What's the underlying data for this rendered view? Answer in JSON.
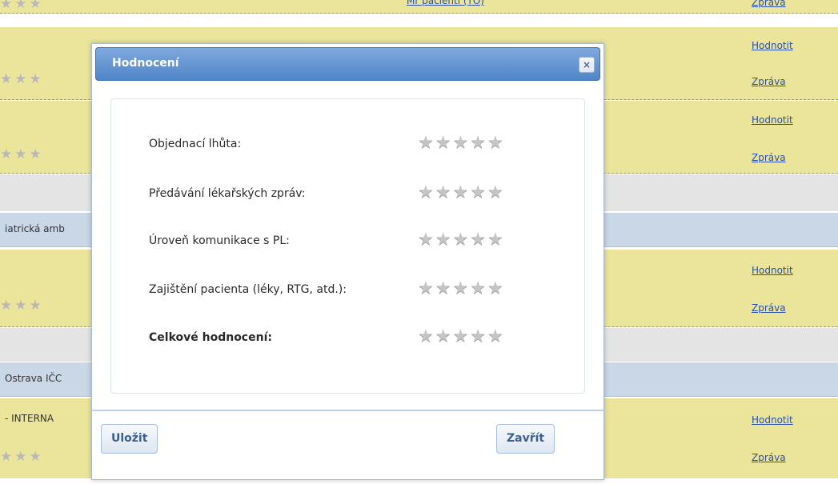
{
  "background": {
    "top_link": "Mr pacienti (TO)",
    "links": [
      {
        "label": "Zpráva"
      },
      {
        "label": "Hodnotit"
      },
      {
        "label": "Zpráva"
      },
      {
        "label": "Hodnotit"
      },
      {
        "label": "Zpráva"
      },
      {
        "label": "Hodnotit"
      },
      {
        "label": "Zpráva"
      },
      {
        "label": "Hodnotit"
      },
      {
        "label": "Zpráva"
      }
    ],
    "section_labels": [
      "iatrická amb",
      "Ostrava IČC",
      "- INTERNA"
    ]
  },
  "dialog": {
    "title": "Hodnocení",
    "close_symbol": "×",
    "rating_rows": [
      {
        "label": "Objednací lhůta:",
        "stars": 0,
        "bold": false
      },
      {
        "label": "Předávání lékařských zpráv:",
        "stars": 0,
        "bold": false
      },
      {
        "label": "Úroveň komunikace s PL:",
        "stars": 0,
        "bold": false
      },
      {
        "label": "Zajištění pacienta (léky, RTG, atd.):",
        "stars": 0,
        "bold": false
      },
      {
        "label": "Celkové hodnocení:",
        "stars": 0,
        "bold": true
      }
    ],
    "max_stars": 5,
    "buttons": {
      "save": "Uložit",
      "close": "Zavřít"
    }
  },
  "colors": {
    "row_yellow": "#ebe59c",
    "row_blue": "#c9d7e6",
    "titlebar": "#4f85c8",
    "link": "#2a4fa8"
  }
}
